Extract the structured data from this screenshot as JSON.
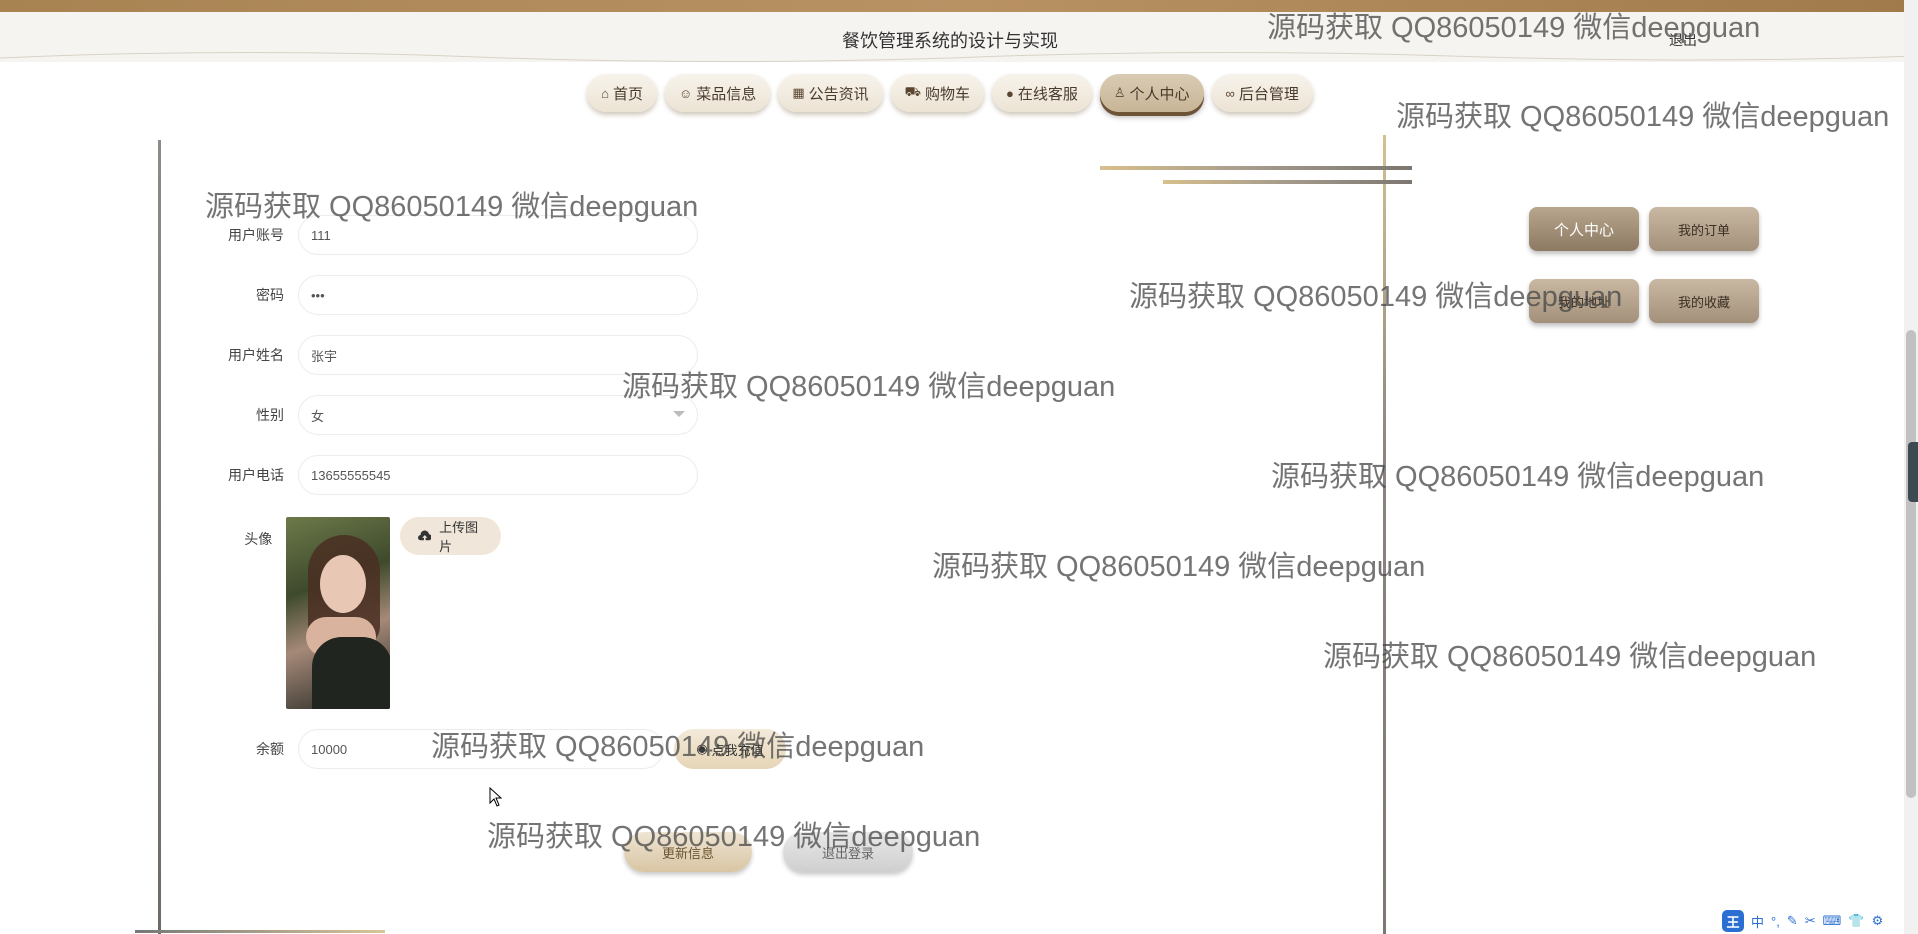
{
  "header": {
    "title": "餐饮管理系统的设计与实现",
    "logout": "退出"
  },
  "nav": {
    "items": [
      {
        "label": "首页",
        "icon": "home-icon"
      },
      {
        "label": "菜品信息",
        "icon": "dish-icon"
      },
      {
        "label": "公告资讯",
        "icon": "gift-icon"
      },
      {
        "label": "购物车",
        "icon": "cart-icon"
      },
      {
        "label": "在线客服",
        "icon": "chat-icon"
      },
      {
        "label": "个人中心",
        "icon": "user-icon",
        "active": true
      },
      {
        "label": "后台管理",
        "icon": "link-icon"
      }
    ]
  },
  "form": {
    "account": {
      "label": "用户账号",
      "value": "111"
    },
    "password": {
      "label": "密码",
      "value": "•••"
    },
    "name": {
      "label": "用户姓名",
      "value": "张宇"
    },
    "gender": {
      "label": "性别",
      "value": "女"
    },
    "phone": {
      "label": "用户电话",
      "value": "13655555545"
    },
    "avatar": {
      "label": "头像",
      "upload_label": "上传图片"
    },
    "balance": {
      "label": "余额",
      "value": "10000",
      "recharge_label": "点我充值"
    },
    "update_label": "更新信息",
    "logout_label": "退出登录"
  },
  "side_menu": {
    "items": [
      {
        "label": "个人中心",
        "active": true
      },
      {
        "label": "我的订单"
      },
      {
        "label": "我的地址"
      },
      {
        "label": "我的收藏"
      }
    ]
  },
  "watermark": {
    "text": "源码获取 QQ86050149 微信deepguan"
  },
  "ime": {
    "logo": "王",
    "items": [
      "中",
      "°,",
      "✎",
      "✂",
      "⌨",
      "👕",
      "⚙"
    ]
  },
  "colors": {
    "accent": "#a88352",
    "nav_bg": "#ece3d4",
    "active_side": "#8d7a63"
  }
}
